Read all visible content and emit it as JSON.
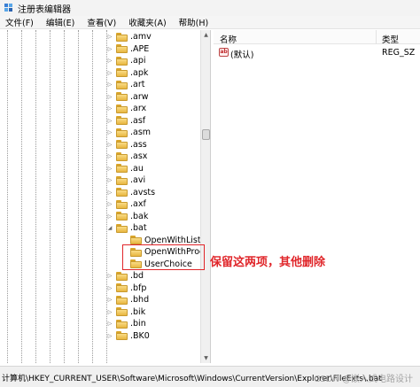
{
  "window": {
    "title": "注册表编辑器"
  },
  "menu": [
    "文件(F)",
    "编辑(E)",
    "查看(V)",
    "收藏夹(A)",
    "帮助(H)"
  ],
  "tree": {
    "items": [
      {
        "label": ".amv",
        "expander": "▷"
      },
      {
        "label": ".APE",
        "expander": "▷"
      },
      {
        "label": ".api",
        "expander": "▷"
      },
      {
        "label": ".apk",
        "expander": "▷"
      },
      {
        "label": ".art",
        "expander": "▷"
      },
      {
        "label": ".arw",
        "expander": "▷"
      },
      {
        "label": ".arx",
        "expander": "▷"
      },
      {
        "label": ".asf",
        "expander": "▷"
      },
      {
        "label": ".asm",
        "expander": "▷"
      },
      {
        "label": ".ass",
        "expander": "▷"
      },
      {
        "label": ".asx",
        "expander": "▷"
      },
      {
        "label": ".au",
        "expander": "▷"
      },
      {
        "label": ".avi",
        "expander": "▷"
      },
      {
        "label": ".avsts",
        "expander": "▷"
      },
      {
        "label": ".axf",
        "expander": "▷"
      },
      {
        "label": ".bak",
        "expander": "▷"
      },
      {
        "label": ".bat",
        "expander": "◢"
      },
      {
        "label": "OpenWithList",
        "expander": "",
        "child": true
      },
      {
        "label": "OpenWithProgid",
        "expander": "",
        "child": true
      },
      {
        "label": "UserChoice",
        "expander": "",
        "child": true
      },
      {
        "label": ".bd",
        "expander": "▷"
      },
      {
        "label": ".bfp",
        "expander": "▷"
      },
      {
        "label": ".bhd",
        "expander": "▷"
      },
      {
        "label": ".bik",
        "expander": "▷"
      },
      {
        "label": ".bin",
        "expander": "▷"
      },
      {
        "label": ".BK0",
        "expander": "▷"
      }
    ]
  },
  "list": {
    "headers": {
      "name": "名称",
      "type": "类型"
    },
    "rows": [
      {
        "icon": "string-value-icon",
        "icon_text": "ab",
        "name": "(默认)",
        "type": "REG_SZ"
      }
    ]
  },
  "status": {
    "path": "计算机\\HKEY_CURRENT_USER\\Software\\Microsoft\\Windows\\CurrentVersion\\Explorer\\FileExts\\.bat"
  },
  "watermark": "CSDN @嵌入式电路设计",
  "annotation": {
    "text": "保留这两项，其他删除",
    "color": "#e0262a"
  }
}
